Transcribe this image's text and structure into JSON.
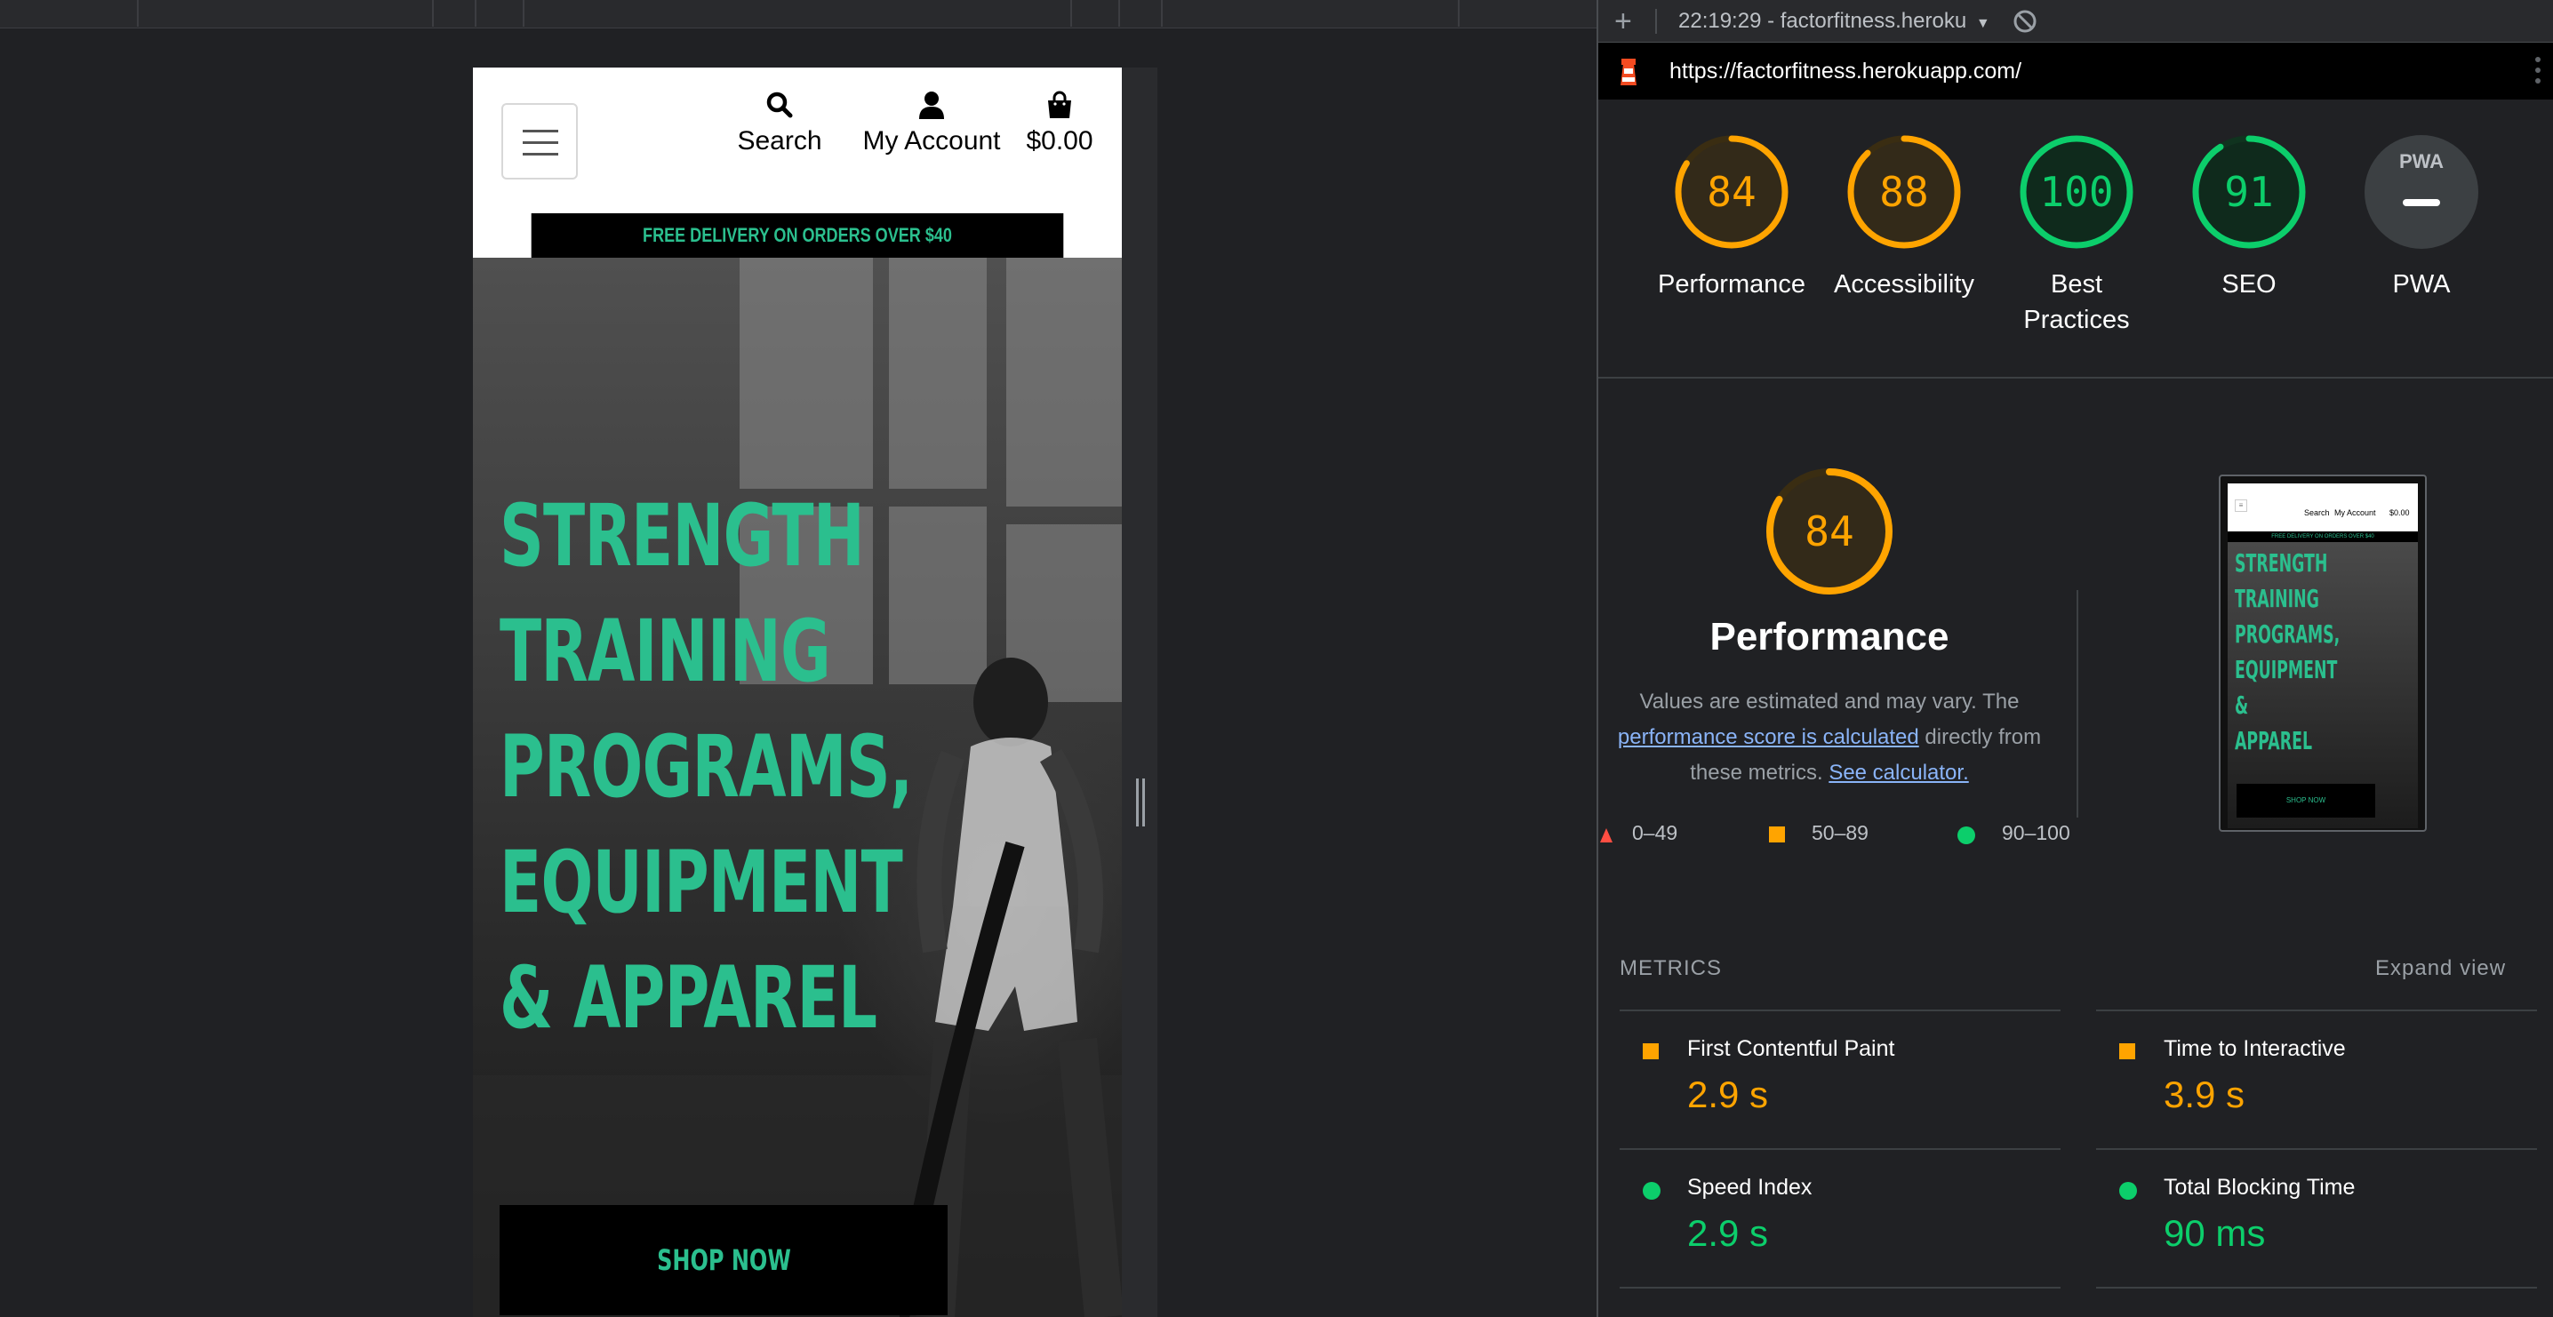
{
  "devtools": {
    "add_tab_icon": "plus-icon",
    "report_selector": "22:19:29 - factorfitness.heroku",
    "url": "https://factorfitness.herokuapp.com/",
    "menu_icon": "kebab-menu-icon"
  },
  "site": {
    "header": {
      "search_label": "Search",
      "account_label": "My Account",
      "cart_label": "$0.00"
    },
    "delivery_banner": "FREE DELIVERY ON ORDERS OVER $40",
    "hero_lines": [
      "STRENGTH",
      "TRAINING",
      "PROGRAMS,",
      "EQUIPMENT",
      "& APPAREL"
    ],
    "cta_label": "SHOP NOW"
  },
  "lighthouse": {
    "gauges": [
      {
        "label_1": "Performance",
        "label_2": "",
        "score": "84",
        "value": 84,
        "color": "#ffa400"
      },
      {
        "label_1": "Accessibility",
        "label_2": "",
        "score": "88",
        "value": 88,
        "color": "#ffa400"
      },
      {
        "label_1": "Best",
        "label_2": "Practices",
        "score": "100",
        "value": 100,
        "color": "#0cce6b"
      },
      {
        "label_1": "SEO",
        "label_2": "",
        "score": "91",
        "value": 91,
        "color": "#0cce6b"
      },
      {
        "label_1": "PWA",
        "label_2": "",
        "score": "PWA",
        "value": 0,
        "color": "#9aa0a6"
      }
    ],
    "performance": {
      "score": "84",
      "value": 84,
      "title": "Performance",
      "desc_1": "Values are estimated and may vary. The",
      "desc_link": "performance score is calculated",
      "desc_2": "directly from",
      "desc_3": "these metrics.",
      "calc_link": "See calculator."
    },
    "legend": {
      "fail": "0–49",
      "average": "50–89",
      "pass": "90–100",
      "fail_color": "#ff4e42",
      "average_color": "#ffa400",
      "pass_color": "#0cce6b"
    },
    "metrics_heading": "METRICS",
    "expand_label": "Expand view",
    "metrics": [
      {
        "name": "First Contentful Paint",
        "value": "2.9 s",
        "status": "average"
      },
      {
        "name": "Time to Interactive",
        "value": "3.9 s",
        "status": "average"
      },
      {
        "name": "Speed Index",
        "value": "2.9 s",
        "status": "pass"
      },
      {
        "name": "Total Blocking Time",
        "value": "90 ms",
        "status": "pass"
      }
    ],
    "thumbnail": {
      "search": "Search",
      "account": "My Account",
      "cart": "$0.00",
      "banner": "FREE DELIVERY ON ORDERS OVER $40",
      "hero_lines": [
        "STRENGTH",
        "TRAINING",
        "PROGRAMS,",
        "EQUIPMENT",
        "&",
        "APPAREL"
      ],
      "cta": "SHOP NOW"
    }
  }
}
